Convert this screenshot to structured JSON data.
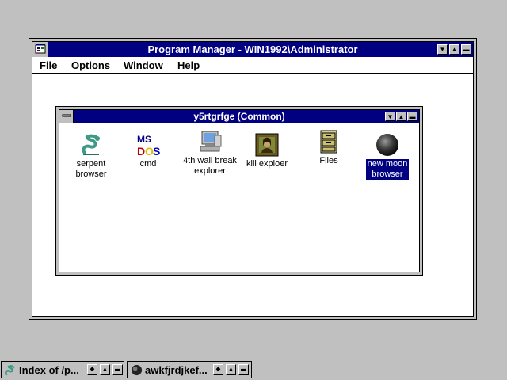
{
  "program_manager": {
    "title": "Program Manager - WIN1992\\Administrator",
    "menu": [
      "File",
      "Options",
      "Window",
      "Help"
    ]
  },
  "group_window": {
    "title": "y5rtgrfge (Common)",
    "icons": [
      {
        "label_line1": "serpent",
        "label_line2": "browser",
        "icon": "serpent-icon"
      },
      {
        "label_line1": "cmd",
        "label_line2": "",
        "icon": "ms-dos-icon"
      },
      {
        "label_line1": "4th wall break",
        "label_line2": "explorer",
        "icon": "computer-icon"
      },
      {
        "label_line1": "kill exploer",
        "label_line2": "",
        "icon": "framed-portrait-icon"
      },
      {
        "label_line1": "Files",
        "label_line2": "",
        "icon": "file-cabinet-icon"
      },
      {
        "label_line1": "new moon",
        "label_line2": "browser",
        "icon": "moon-icon",
        "selected": true
      }
    ]
  },
  "taskbar": {
    "items": [
      {
        "label": "Index of /p...",
        "icon": "serpent-icon"
      },
      {
        "label": "awkfjrdjkef...",
        "icon": "moon-icon"
      }
    ]
  },
  "colors": {
    "desktop": "#c0c0c0",
    "titlebar": "#000080",
    "selection": "#000080"
  }
}
